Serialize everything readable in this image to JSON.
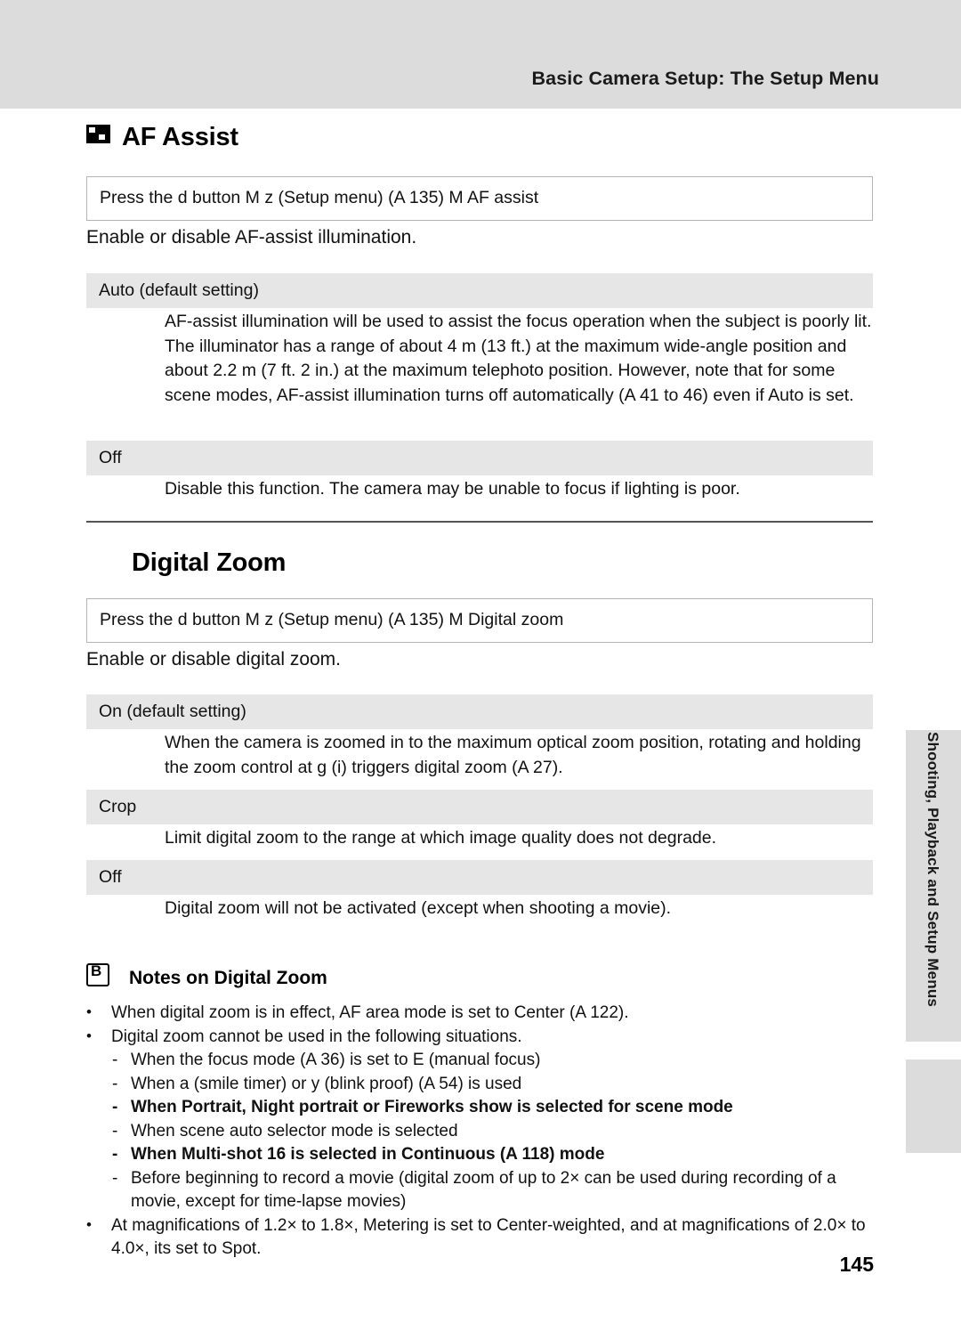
{
  "header": {
    "title": "Basic Camera Setup: The Setup Menu"
  },
  "side_tab": {
    "label": "Shooting, Playback and Setup Menus"
  },
  "sections": [
    {
      "title": "AF Assist",
      "has_icon": true,
      "press_path": "Press the d button M z (Setup menu) (A 135) M AF assist",
      "lead": "Enable or disable AF-assist illumination.",
      "options": [
        {
          "name": "Auto (default setting)",
          "body": "AF-assist illumination will be used to assist the focus operation when the subject is poorly lit. The illuminator has a range of about 4 m (13 ft.) at the maximum wide-angle position and about 2.2 m (7 ft. 2 in.) at the maximum telephoto position. However, note that for some scene modes, AF-assist illumination turns off automatically (A 41 to 46) even if Auto is set."
        },
        {
          "name": "Off",
          "body": "Disable this function. The camera may be unable to focus if lighting is poor."
        }
      ]
    },
    {
      "title": "Digital Zoom",
      "has_icon": false,
      "press_path": "Press the d button M z (Setup menu) (A 135) M Digital zoom",
      "lead": "Enable or disable digital zoom.",
      "options": [
        {
          "name": "On (default setting)",
          "body": "When the camera is zoomed in to the maximum optical zoom position, rotating and holding the zoom control at g (i) triggers digital zoom (A 27)."
        },
        {
          "name": "Crop",
          "body": "Limit digital zoom to the range at which image quality does not degrade."
        },
        {
          "name": "Off",
          "body": "Digital zoom will not be activated (except when shooting a movie)."
        }
      ]
    }
  ],
  "notes": {
    "title": "Notes on Digital Zoom",
    "items": [
      "When digital zoom is in effect, AF area mode is set to Center (A 122).",
      "Digital zoom cannot be used in the following situations.",
      "When the focus mode (A 36) is set to E (manual focus)",
      "When a (smile timer) or y (blink proof) (A 54) is used",
      "When Portrait, Night portrait or Fireworks show is selected for scene mode",
      "When scene auto selector mode is selected",
      "When Multi-shot 16 is selected in Continuous (A 118) mode",
      "Before beginning to record a movie (digital zoom of up to 2× can be used during recording of a movie, except for time-lapse movies)",
      "At magnifications of 1.2× to 1.8×, Metering is set to Center-weighted, and at magnifications of 2.0× to 4.0×, its set to Spot."
    ]
  },
  "page_number": "145"
}
